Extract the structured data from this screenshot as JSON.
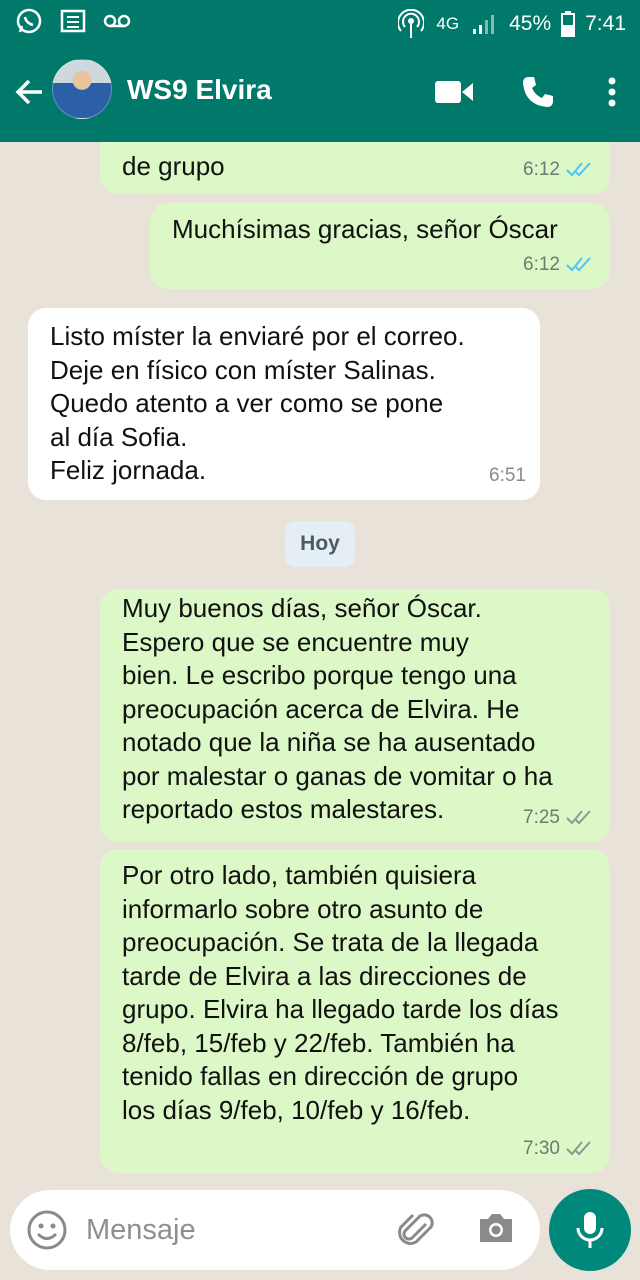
{
  "status_bar": {
    "network": "4G",
    "battery": "45%",
    "time": "7:41"
  },
  "header": {
    "contact_name": "WS9 Elvira"
  },
  "messages": [
    {
      "direction": "out",
      "text": "de grupo",
      "time": "6:12",
      "status": "read"
    },
    {
      "direction": "out",
      "text": "Muchísimas gracias, señor Óscar",
      "time": "6:12",
      "status": "read"
    },
    {
      "direction": "in",
      "text": "Listo míster la enviaré por el correo.\nDeje en físico con míster  Salinas.\nQuedo atento a ver como se pone\nal día Sofia.\nFeliz jornada.",
      "time": "6:51"
    },
    {
      "direction": "out",
      "text": "Muy buenos días, señor Óscar.\nEspero que se encuentre muy\nbien. Le escribo porque tengo una\npreocupación acerca de Elvira. He\nnotado que la niña se ha ausentado\npor malestar o ganas de vomitar o ha\nreportado estos malestares.",
      "time": "7:25",
      "status": "delivered"
    },
    {
      "direction": "out",
      "text": "Por otro lado, también quisiera\ninformarlo sobre  otro asunto de\npreocupación. Se trata de la llegada\ntarde de Elvira a las direcciones de\ngrupo. Elvira ha llegado tarde los días\n8/feb, 15/feb y 22/feb. También ha\ntenido fallas en dirección de grupo\nlos días 9/feb, 10/feb y 16/feb.",
      "time": "7:30",
      "status": "delivered"
    }
  ],
  "date_separator": "Hoy",
  "input": {
    "placeholder": "Mensaje"
  },
  "colors": {
    "header": "#00796b",
    "outgoing_bubble": "#dcf8c6",
    "incoming_bubble": "#ffffff",
    "read_ticks": "#4fc3f7",
    "delivered_ticks": "#8a9a91",
    "fab": "#00897b"
  }
}
